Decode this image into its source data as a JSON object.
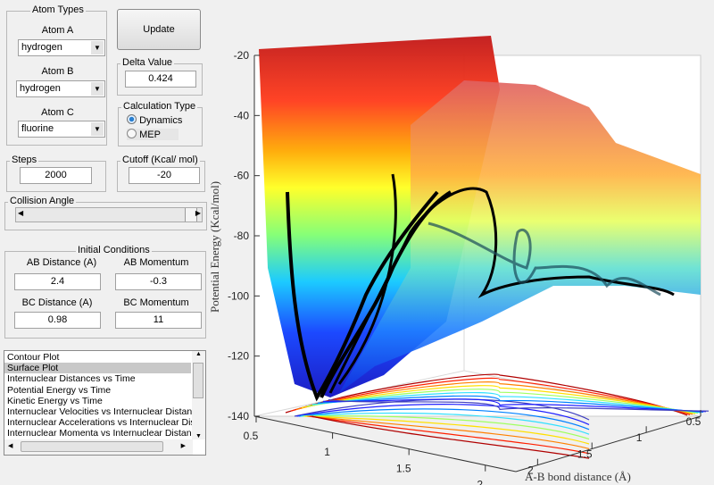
{
  "atom_types": {
    "title": "Atom Types",
    "atom_a_label": "Atom A",
    "atom_a": "hydrogen",
    "atom_b_label": "Atom B",
    "atom_b": "hydrogen",
    "atom_c_label": "Atom C",
    "atom_c": "fluorine"
  },
  "update_label": "Update",
  "delta": {
    "title": "Delta Value",
    "value": "0.424"
  },
  "calc": {
    "title": "Calculation Type",
    "options": [
      "Dynamics",
      "MEP"
    ],
    "selected": "Dynamics"
  },
  "steps": {
    "title": "Steps",
    "value": "2000"
  },
  "cutoff": {
    "title": "Cutoff (Kcal/ mol)",
    "value": "-20"
  },
  "collision": {
    "title": "Collision Angle",
    "value_fraction": 0.95
  },
  "initial": {
    "title": "Initial Conditions",
    "ab_dist_label": "AB Distance (A)",
    "ab_dist": "2.4",
    "ab_mom_label": "AB Momentum",
    "ab_mom": "-0.3",
    "bc_dist_label": "BC Distance (A)",
    "bc_dist": "0.98",
    "bc_mom_label": "BC Momentum",
    "bc_mom": "11"
  },
  "plot_list": {
    "items": [
      "Contour Plot",
      "Surface Plot",
      "Internuclear Distances vs Time",
      "Potential Energy vs Time",
      "Kinetic Energy vs Time",
      "Internuclear Velocities vs Internuclear Distance",
      "Internuclear Accelerations vs Internuclear Dista",
      "Internuclear Momenta vs Internuclear Distance"
    ],
    "selected": "Surface Plot"
  },
  "chart_data": {
    "type": "surface",
    "zlabel": "Potential Energy (Kcal/mol)",
    "ylabel": "A-B bond distance (Å)",
    "zticks": [
      "-20",
      "-40",
      "-60",
      "-80",
      "-100",
      "-120",
      "-140"
    ],
    "zlim": [
      -140,
      -20
    ],
    "xticks": [
      "0.5",
      "1",
      "1.5",
      "2"
    ],
    "yticks": [
      "0.5",
      "1",
      "1.5",
      "2"
    ],
    "colormap": "jet"
  }
}
